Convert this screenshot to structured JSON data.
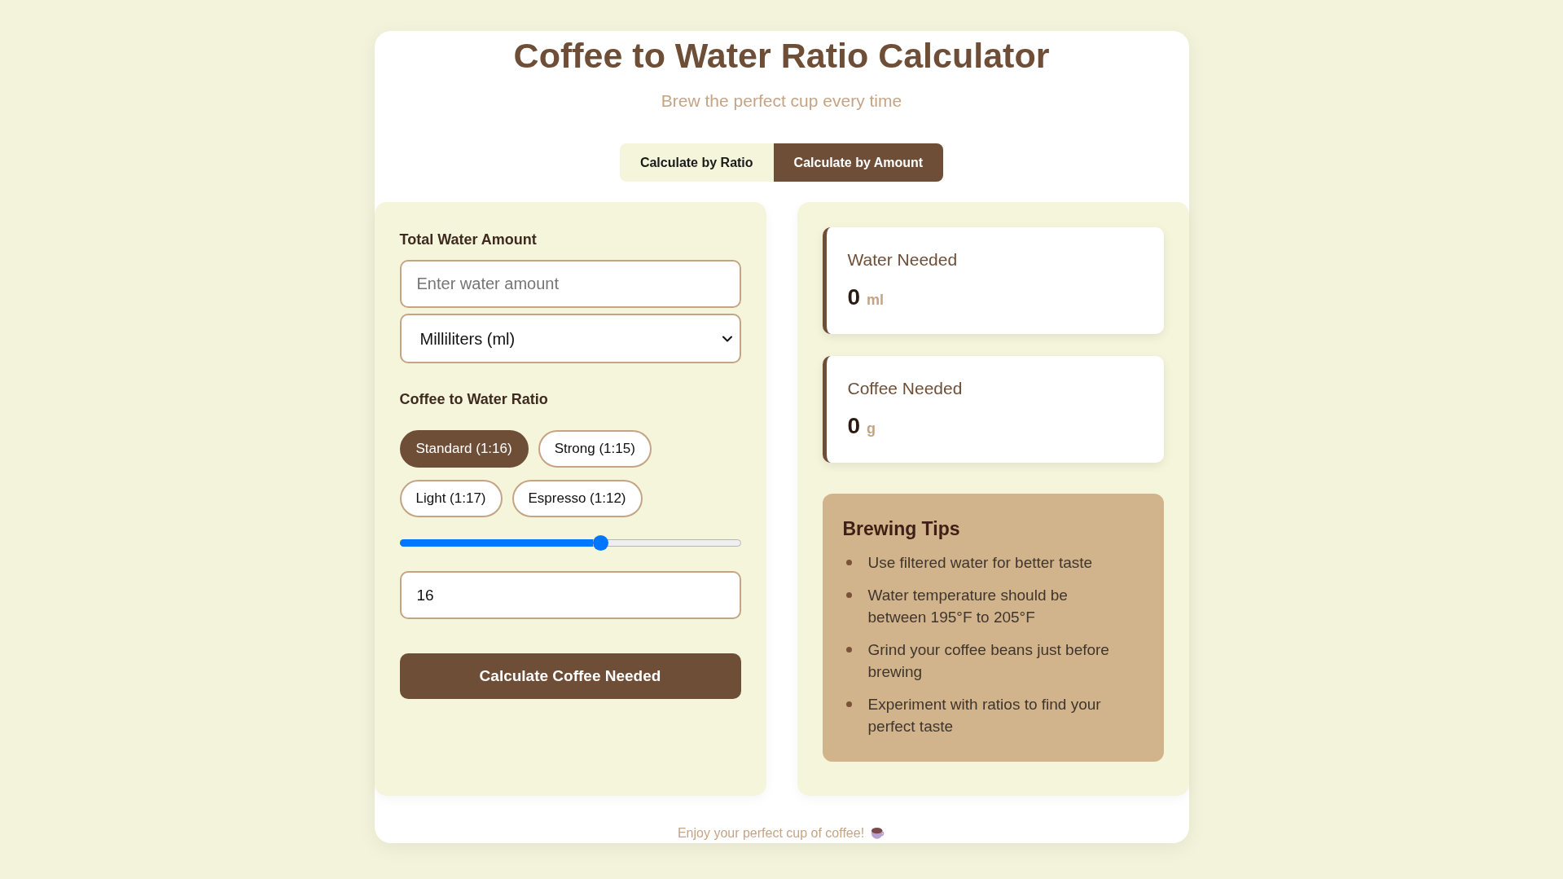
{
  "header": {
    "title": "Coffee to Water Ratio Calculator",
    "subtitle": "Brew the perfect cup every time"
  },
  "tabs": [
    {
      "label": "Calculate by Ratio",
      "selected": false
    },
    {
      "label": "Calculate by Amount",
      "selected": true
    }
  ],
  "inputs": {
    "water_label": "Total Water Amount",
    "water_field": {
      "placeholder": "Enter water amount"
    },
    "unit_select": {
      "value": "Milliliters (ml)"
    },
    "ratio_label": "Coffee to Water Ratio",
    "presets": [
      {
        "label": "Standard (1:16)",
        "selected": true
      },
      {
        "label": "Strong (1:15)",
        "selected": false
      },
      {
        "label": "Light (1:17)",
        "selected": false
      },
      {
        "label": "Espresso (1:12)",
        "selected": false
      }
    ],
    "ratio_slider": {
      "level": 0.59
    },
    "ratio_field": {
      "value": "16"
    },
    "calculate_button": "Calculate Coffee Needed"
  },
  "results": [
    {
      "label": "Water Needed",
      "value": "0",
      "unit": "ml"
    },
    {
      "label": "Coffee Needed",
      "value": "0",
      "unit": "g"
    }
  ],
  "tips": {
    "title": "Brewing Tips",
    "items": [
      "Use filtered water for better taste",
      "Water temperature should be between 195°F to 205°F",
      "Grind your coffee beans just before brewing",
      "Experiment with ratios to find your perfect taste"
    ]
  },
  "footer": "Enjoy your perfect cup of coffee!"
}
